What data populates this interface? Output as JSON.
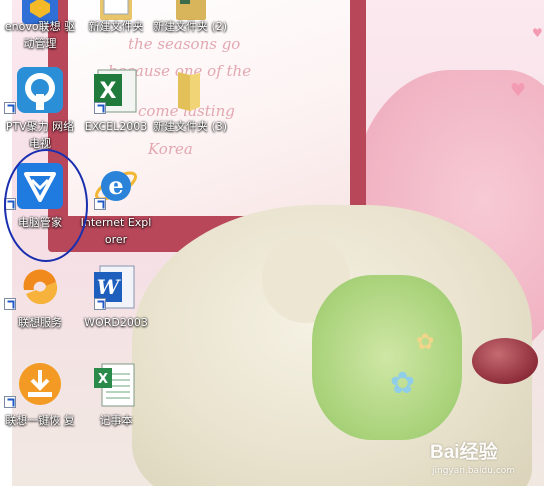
{
  "desktop": {
    "icons": [
      {
        "label": "enovo联想 驱动管理",
        "icon": "lenovo-driver-icon"
      },
      {
        "label": "新建文件夹",
        "icon": "new-folder-icon"
      },
      {
        "label": "新建文件夹 (2)",
        "icon": "new-folder-2-icon"
      },
      {
        "label": "PTV聚力 网络电视",
        "icon": "pptv-icon"
      },
      {
        "label": "EXCEL2003",
        "icon": "excel-icon"
      },
      {
        "label": "新建文件夹 (3)",
        "icon": "folder-icon"
      },
      {
        "label": "电脑管家",
        "icon": "pc-manager-icon"
      },
      {
        "label": "Internet Explorer",
        "icon": "internet-explorer-icon"
      },
      {
        "label": "联想服务",
        "icon": "lenovo-service-icon"
      },
      {
        "label": "WORD2003",
        "icon": "word-icon"
      },
      {
        "label": "联想一键恢 复",
        "icon": "lenovo-onekey-recovery-icon"
      },
      {
        "label": "记事本",
        "icon": "notepad-icon"
      }
    ]
  },
  "wallpaper": {
    "script_lines": [
      "the seasons go",
      "because one of the",
      "come lasting",
      "Korea"
    ],
    "watermark_brand": "Bai经验",
    "watermark_url": "jingyan.baidu.com"
  },
  "colors": {
    "annotation": "#1a2fb0",
    "frame": "#b8475a",
    "pc_manager_blue": "#1f7be0"
  }
}
